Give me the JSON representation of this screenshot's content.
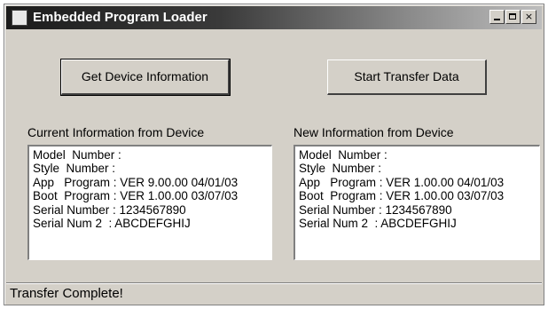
{
  "window": {
    "title": "Embedded Program Loader",
    "controls": {
      "minimize": "_",
      "maximize": "□",
      "close": "×"
    }
  },
  "buttons": {
    "get_info": "Get Device Information",
    "start_transfer": "Start Transfer Data"
  },
  "current": {
    "label": "Current Information from Device",
    "lines": [
      "Model  Number :",
      "Style  Number :",
      "App   Program : VER 9.00.00 04/01/03",
      "Boot  Program : VER 1.00.00 03/07/03",
      "Serial Number : 1234567890",
      "Serial Num 2  : ABCDEFGHIJ"
    ]
  },
  "new": {
    "label": "New Information from Device",
    "lines": [
      "Model  Number :",
      "Style  Number :",
      "App   Program : VER 1.00.00 04/01/03",
      "Boot  Program : VER 1.00.00 03/07/03",
      "Serial Number : 1234567890",
      "Serial Num 2  : ABCDEFGHIJ"
    ]
  },
  "status": {
    "text": "Transfer Complete!"
  }
}
